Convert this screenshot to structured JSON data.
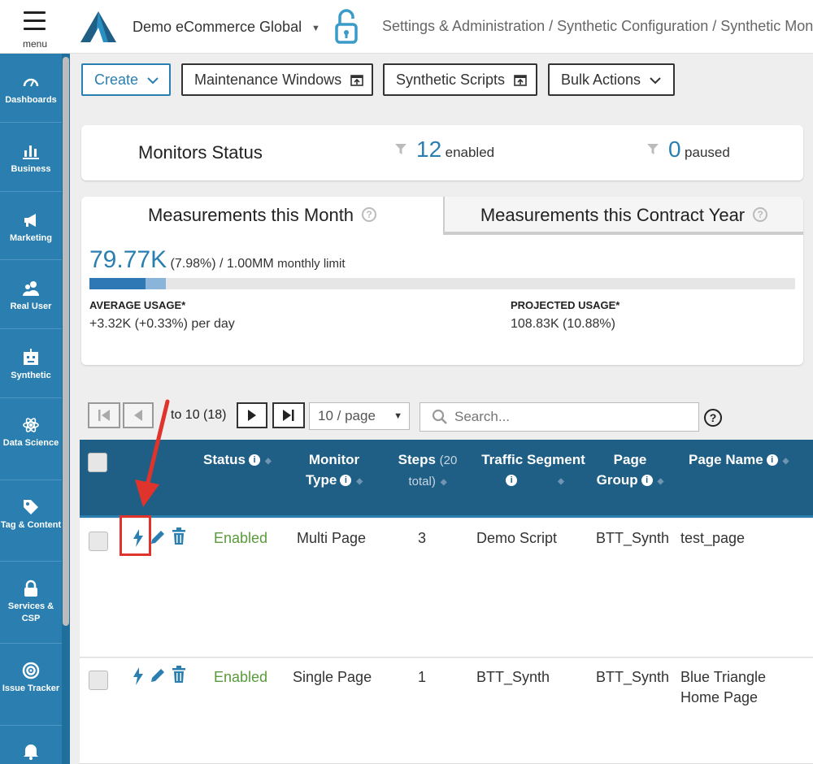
{
  "header": {
    "menu_label": "menu",
    "org_name": "Demo eCommerce Global",
    "breadcrumb": "Settings & Administration / Synthetic Configuration / Synthetic Monit"
  },
  "sidebar": {
    "items": [
      {
        "label": "Dashboards",
        "icon": "gauge-icon"
      },
      {
        "label": "Business",
        "icon": "bar-chart-icon"
      },
      {
        "label": "Marketing",
        "icon": "megaphone-icon"
      },
      {
        "label": "Real User",
        "icon": "users-icon"
      },
      {
        "label": "Synthetic",
        "icon": "robot-icon"
      },
      {
        "label": "Data Science",
        "icon": "atom-icon"
      },
      {
        "label": "Tag & Content",
        "icon": "tag-icon"
      },
      {
        "label": "Services & CSP",
        "icon": "lock-icon"
      },
      {
        "label": "Issue Tracker",
        "icon": "target-icon"
      },
      {
        "label": "",
        "icon": "bell-icon"
      }
    ]
  },
  "toolbar": {
    "create": "Create",
    "maintenance": "Maintenance Windows",
    "scripts": "Synthetic Scripts",
    "bulk": "Bulk Actions"
  },
  "monitors_status": {
    "title": "Monitors Status",
    "enabled_count": "12",
    "enabled_label": "enabled",
    "paused_count": "0",
    "paused_label": "paused"
  },
  "measurements": {
    "tab_month": "Measurements this Month",
    "tab_year": "Measurements this Contract Year",
    "used": "79.77K",
    "used_detail": "(7.98%) / 1.00MM",
    "limit_label": "monthly limit",
    "usage_fraction": 0.0798,
    "projected_fraction": 0.1088,
    "avg_label": "AVERAGE USAGE*",
    "avg_value": "+3.32K (+0.33%) per day",
    "proj_label": "PROJECTED USAGE*",
    "proj_value": "108.83K (10.88%)"
  },
  "pager": {
    "range_text": "to 10 (18)",
    "per_page": "10 / page",
    "search_placeholder": "Search..."
  },
  "table": {
    "headers": {
      "status": "Status",
      "monitor_type_1": "Monitor",
      "monitor_type_2": "Type",
      "steps": "Steps",
      "steps_sub_1": "(20",
      "steps_sub_2": "total)",
      "traffic_segment": "Traffic Segment",
      "page_group_1": "Page",
      "page_group_2": "Group",
      "page_name": "Page Name"
    },
    "rows": [
      {
        "status": "Enabled",
        "type": "Multi Page",
        "steps": "3",
        "segment": "Demo Script",
        "group": "BTT_Synth",
        "page_name_1": "test_page",
        "page_name_2": ""
      },
      {
        "status": "Enabled",
        "type": "Single Page",
        "steps": "1",
        "segment": "BTT_Synth",
        "group": "BTT_Synth",
        "page_name_1": "Blue Triangle",
        "page_name_2": "Home Page"
      }
    ]
  },
  "colors": {
    "sidebar": "#2a7fb0",
    "table_header": "#1f5f86",
    "accent": "#2a7fb0",
    "enabled": "#5a9a3a",
    "highlight": "#e0332b"
  }
}
